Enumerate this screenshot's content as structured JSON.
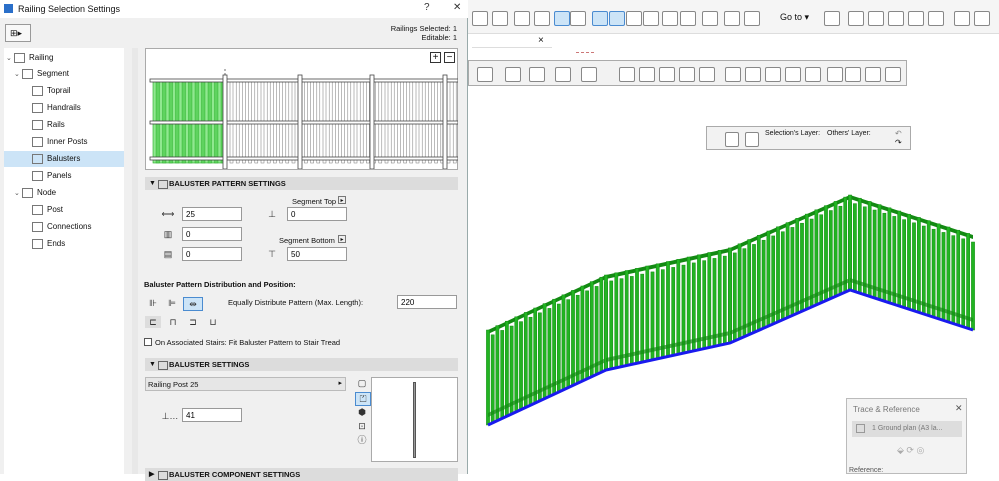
{
  "dialog": {
    "title": "Railing Selection Settings",
    "help": "?",
    "close": "✕",
    "railings_selected": "Railings Selected: 1",
    "editable": "Editable: 1"
  },
  "tree": {
    "items": [
      {
        "label": "Railing",
        "caret": "⌄"
      },
      {
        "label": "Segment",
        "caret": "⌄"
      },
      {
        "label": "Toprail"
      },
      {
        "label": "Handrails"
      },
      {
        "label": "Rails"
      },
      {
        "label": "Inner Posts"
      },
      {
        "label": "Balusters"
      },
      {
        "label": "Panels"
      },
      {
        "label": "Node",
        "caret": "⌄"
      },
      {
        "label": "Post"
      },
      {
        "label": "Connections"
      },
      {
        "label": "Ends"
      }
    ]
  },
  "pattern": {
    "header": "BALUSTER PATTERN SETTINGS",
    "offset_value": "25",
    "spacing_value": "0",
    "count_value": "0",
    "segment_top_label": "Segment Top",
    "segment_top_value": "0",
    "segment_bottom_label": "Segment Bottom",
    "segment_bottom_value": "50",
    "distribution_heading": "Baluster Pattern Distribution and Position:",
    "equally_label": "Equally Distribute Pattern (Max. Length):",
    "equally_value": "220",
    "stairs_label": "On Associated Stairs: Fit Baluster Pattern to Stair Tread"
  },
  "baluster": {
    "header": "BALUSTER SETTINGS",
    "profile": "Railing Post 25",
    "size_value": "41",
    "component_header": "BALUSTER COMPONENT SETTINGS"
  },
  "tab": {
    "close": "×"
  },
  "toolbar": {
    "goto": "Go to"
  },
  "layers": {
    "selection": "Selection's Layer:",
    "others": "Others' Layer:"
  },
  "trace": {
    "title": "Trace & Reference",
    "close": "✕",
    "ref_item": "1 Ground plan (A3 la...",
    "reference_label": "Reference:"
  },
  "colors": {
    "railing_green": "#22b422",
    "railing_dark": "#138a13",
    "base_line": "#1a1aee",
    "selection_blue": "#cce4f7"
  }
}
